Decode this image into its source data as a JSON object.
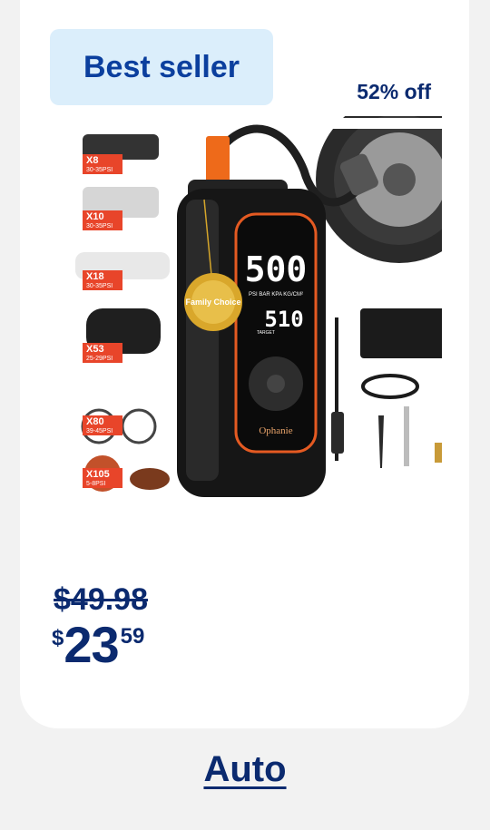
{
  "card": {
    "badge": "Best seller",
    "discount": "52% off",
    "product_image": {
      "vehicle_labels": [
        {
          "model": "X8",
          "psi": "30-35PSI"
        },
        {
          "model": "X10",
          "psi": "30-35PSI"
        },
        {
          "model": "X18",
          "psi": "30-35PSI"
        },
        {
          "model": "X53",
          "psi": "25-29PSI"
        },
        {
          "model": "X80",
          "psi": "39-45PSI"
        },
        {
          "model": "X105",
          "psi": "5-8PSI"
        }
      ],
      "display_main": "500",
      "display_units": "PSI BAR KPA KG/CM²",
      "display_target": "510",
      "display_target_label": "TARGET",
      "brand": "Ophanie",
      "medal_text": "Family Choice"
    },
    "price_original": "$49.98",
    "price_current": {
      "currency": "$",
      "dollars": "23",
      "cents": "59"
    }
  },
  "category_link": "Auto"
}
